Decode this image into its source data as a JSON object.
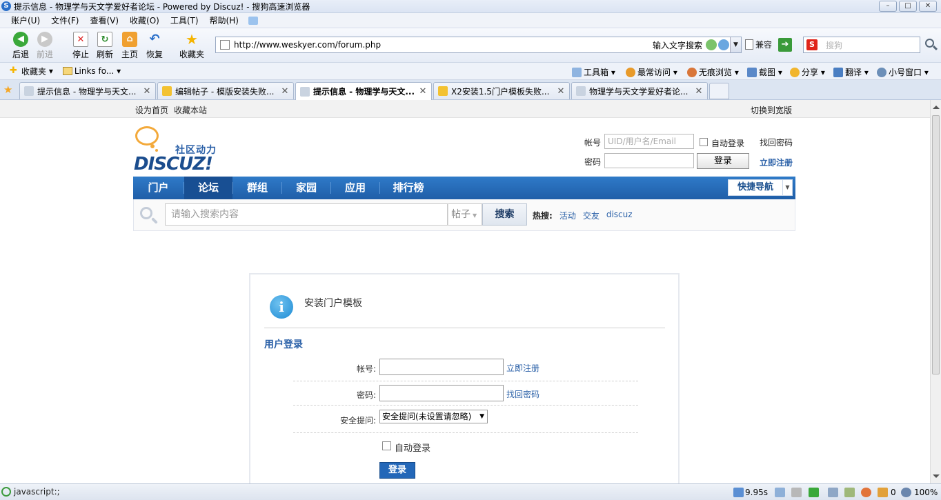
{
  "window": {
    "title": "提示信息 - 物理学与天文学爱好者论坛 - Powered by Discuz! - 搜狗高速浏览器",
    "minimize": "–",
    "maximize": "□",
    "close": "✕"
  },
  "menu": [
    "账户(U)",
    "文件(F)",
    "查看(V)",
    "收藏(O)",
    "工具(T)",
    "帮助(H)"
  ],
  "nav": {
    "back": "后退",
    "forward": "前进",
    "stop": "停止",
    "refresh": "刷新",
    "home": "主页",
    "restore": "恢复",
    "favorites": "收藏夹"
  },
  "address": {
    "url": "http://www.weskyer.com/forum.php",
    "hint": "输入文字搜索",
    "compat": "兼容",
    "search_placeholder": "搜狗"
  },
  "favbar": {
    "favorites": "收藏夹",
    "links": "Links fo...",
    "tools": [
      "工具箱",
      "最常访问",
      "无痕浏览",
      "截图",
      "分享",
      "翻译",
      "小号窗口"
    ]
  },
  "tabs": [
    {
      "label": "提示信息 - 物理学与天文...",
      "active": false
    },
    {
      "label": "编辑帖子 - 模版安装失败...",
      "active": false
    },
    {
      "label": "提示信息 - 物理学与天文...",
      "active": true
    },
    {
      "label": "X2安装1.5门户模板失败...",
      "active": false
    },
    {
      "label": "物理学与天文学爱好者论...",
      "active": false
    }
  ],
  "site": {
    "top_left": [
      "设为首页",
      "收藏本站"
    ],
    "top_right": "切换到宽版",
    "logo_cn": "社区动力",
    "logo_en": "DISCUZ!",
    "mini_login": {
      "account_label": "帐号",
      "account_placeholder": "UID/用户名/Email",
      "auto_login": "自动登录",
      "find_password": "找回密码",
      "password_label": "密码",
      "login_button": "登录",
      "register": "立即注册"
    },
    "main_nav": [
      "门户",
      "论坛",
      "群组",
      "家园",
      "应用",
      "排行榜"
    ],
    "quick_nav": "快捷导航",
    "search": {
      "placeholder": "请输入搜索内容",
      "type": "帖子",
      "button": "搜索",
      "hot_label": "热搜:",
      "hot_terms": [
        "活动",
        "交友",
        "discuz"
      ]
    }
  },
  "notice": {
    "message": "安装门户模板",
    "section_title": "用户登录",
    "account_label": "帐号:",
    "register_link": "立即注册",
    "password_label": "密码:",
    "find_password_link": "找回密码",
    "question_label": "安全提问:",
    "question_value": "安全提问(未设置请忽略)",
    "auto_login": "自动登录",
    "submit": "登录"
  },
  "status": {
    "left_text": "javascript:;",
    "time": "9.95s",
    "count": "0",
    "zoom": "100%"
  },
  "colors": {
    "nav_blue": "#2f7ac8",
    "link_blue": "#2b61a8",
    "logo_orange": "#f3a93a",
    "submit_blue": "#2367b8"
  }
}
